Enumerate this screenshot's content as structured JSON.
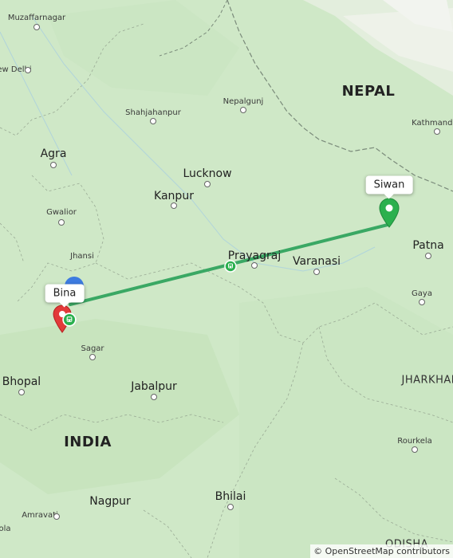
{
  "map": {
    "countries": [
      {
        "name": "NEPAL"
      },
      {
        "name": "INDIA"
      }
    ],
    "states": [
      {
        "name": "JHARKHAND"
      },
      {
        "name": "ODISHA"
      }
    ],
    "cities": [
      {
        "name": "Agra"
      },
      {
        "name": "Kanpur"
      },
      {
        "name": "Lucknow"
      },
      {
        "name": "Prayagraj"
      },
      {
        "name": "Varanasi"
      },
      {
        "name": "Patna"
      },
      {
        "name": "Bhopal"
      },
      {
        "name": "Jabalpur"
      },
      {
        "name": "Nagpur"
      },
      {
        "name": "Bhilai"
      }
    ],
    "towns": [
      {
        "name": "Muzaffarnagar"
      },
      {
        "name": "ew Delhi"
      },
      {
        "name": "Shahjahanpur"
      },
      {
        "name": "Nepalgunj"
      },
      {
        "name": "Kathmandu"
      },
      {
        "name": "Gwalior"
      },
      {
        "name": "Jhansi"
      },
      {
        "name": "Sagar"
      },
      {
        "name": "Gaya"
      },
      {
        "name": "Rourkela"
      },
      {
        "name": "Amravati"
      },
      {
        "name": "ola"
      }
    ],
    "route_labels": {
      "origin": "Bina",
      "destination": "Siwan"
    },
    "attribution": "© OpenStreetMap contributors",
    "colors": {
      "land": "#cfe8c7",
      "route": "#3aa864",
      "destination_marker": "#2bb04e",
      "origin_marker": "#e23a3a",
      "current_marker": "#3d7be0",
      "border": "#7a8a7a"
    }
  }
}
